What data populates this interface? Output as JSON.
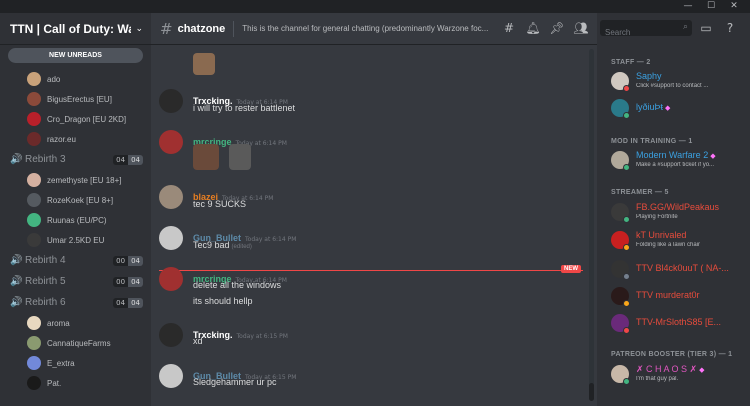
{
  "window": {
    "minimize": "—",
    "maximize": "☐",
    "close": "✕"
  },
  "server": {
    "name": "TTN | Call of Duty: Wa...",
    "new_unreads": "NEW UNREADS"
  },
  "voice_users_top": [
    {
      "name": "ado",
      "color": "#c9a27a"
    },
    {
      "name": "BigusErectus [EU]",
      "color": "#8b4a3a"
    },
    {
      "name": "Cro_Dragon [EU 2KD]",
      "color": "#b8202a"
    },
    {
      "name": "razor.eu",
      "color": "#6b2a2a"
    }
  ],
  "voice_channels": [
    {
      "name": "Rebirth 3",
      "a": "04",
      "b": "04"
    },
    {
      "name": "Rebirth 4",
      "a": "00",
      "b": "04"
    },
    {
      "name": "Rebirth 5",
      "a": "00",
      "b": "04"
    },
    {
      "name": "Rebirth 6",
      "a": "04",
      "b": "04"
    }
  ],
  "voice_users_r3": [
    {
      "name": "zemethyste [EU 18+]",
      "color": "#d4b0a0"
    },
    {
      "name": "RozeKoek [EU 8+]",
      "color": "#555a60"
    },
    {
      "name": "Ruunas (EU/PC)",
      "color": "#43b581"
    },
    {
      "name": "Umar 2.5KD EU",
      "color": "#3a3a3a"
    }
  ],
  "voice_users_r6": [
    {
      "name": "aroma",
      "color": "#e8d8c0"
    },
    {
      "name": "CannatiqueFarms",
      "color": "#8a9a70"
    },
    {
      "name": "E_extra",
      "color": "#7289da"
    },
    {
      "name": "Pat.",
      "color": "#1a1a1a"
    }
  ],
  "channel": {
    "name": "chatzone",
    "topic": "This is the channel for general chatting (predominantly Warzone foc..."
  },
  "header_icons": [
    "threads-icon",
    "bell-icon",
    "pin-icon",
    "members-icon",
    "inbox-icon",
    "help-icon"
  ],
  "search": {
    "placeholder": "Search"
  },
  "messages": {
    "m1": {
      "author": "Trxcking.",
      "time": "Today at 6:14 PM",
      "text": "i will try to rester battlenet",
      "color": "#ffffff"
    },
    "m2": {
      "author": "mrcringe",
      "time": "Today at 6:14 PM",
      "color": "#43b581"
    },
    "m3": {
      "author": "blazei",
      "time": "Today at 6:14 PM",
      "text": "tec 9 SUCKS",
      "color": "#e67e22"
    },
    "m4": {
      "author": "Gun_Bullet",
      "time": "Today at 6:14 PM",
      "text": "Tec9 bad",
      "edited": "(edited)",
      "color": "#5d8aa8"
    },
    "m5": {
      "author": "mrcringe",
      "time": "Today at 6:14 PM",
      "text1": "delete all the windows",
      "text2": "its should hellp",
      "color": "#43b581"
    },
    "m6": {
      "author": "Trxcking.",
      "time": "Today at 6:15 PM",
      "text": "xd",
      "color": "#ffffff"
    },
    "m7": {
      "author": "Gun_Bullet",
      "time": "Today at 6:15 PM",
      "text": "Sledgehammer ur pc",
      "color": "#5d8aa8"
    }
  },
  "new_tag": "NEW",
  "member_groups": {
    "staff": "STAFF — 2",
    "mod": "MOD IN TRAINING — 1",
    "streamer": "STREAMER — 5",
    "booster": "PATREON BOOSTER (TIER 3) — 1"
  },
  "members": {
    "saphy": {
      "name": "Saphy",
      "activity": "Click #support to contact ...",
      "color": "#3ba0e0"
    },
    "lydiupt": {
      "name": "lyðiuÞŧ",
      "color": "#3ba0e0"
    },
    "modern": {
      "name": "Modern Warfare 2",
      "activity": "Make a #support ticket if yo...",
      "color": "#3ba0e0"
    },
    "fb": {
      "name": "FB.GG/WildPeakaus",
      "activity": "Playing Fortnite",
      "color": "#e74c3c"
    },
    "kt": {
      "name": "kT Unrivaled",
      "activity": "Folding like a lawn chair",
      "color": "#e74c3c"
    },
    "ttv1": {
      "name": "TTV Bl4ck0uuT ( NA-...",
      "color": "#e74c3c"
    },
    "ttv2": {
      "name": "TTV murderat0r",
      "color": "#e74c3c"
    },
    "ttv3": {
      "name": "TTV-MrSlothS85 [E...",
      "color": "#e74c3c"
    },
    "chaos": {
      "name": "✗ C H A O S ✗",
      "activity": "I'm that guy pal.",
      "color": "#e056c0"
    }
  }
}
